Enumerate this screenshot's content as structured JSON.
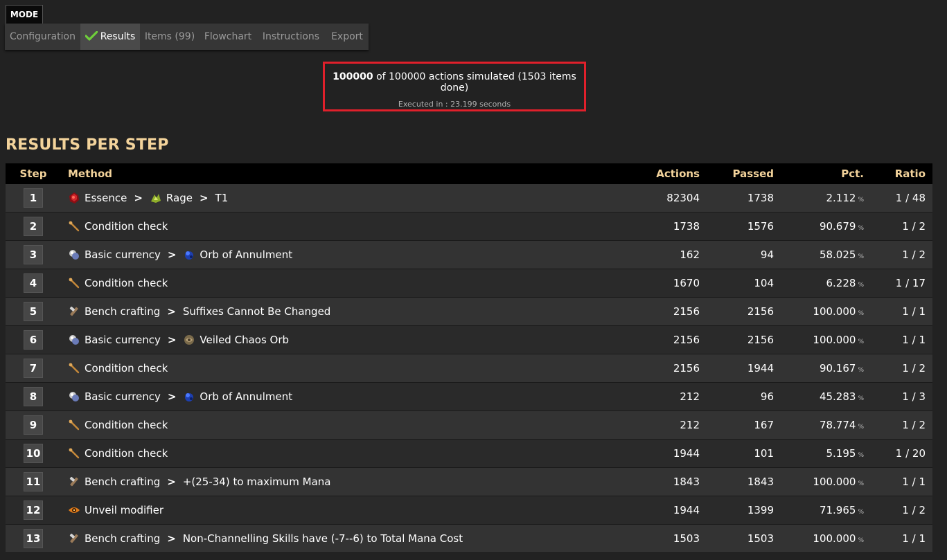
{
  "mode_label": "MODE",
  "nav": [
    {
      "label": "Configuration",
      "active": false,
      "width": 109
    },
    {
      "label": "Results",
      "active": true,
      "width": 86,
      "icon": "check-icon"
    },
    {
      "label": "Items (99)",
      "active": false,
      "width": 86
    },
    {
      "label": "Flowchart",
      "active": false,
      "width": 82
    },
    {
      "label": "Instructions",
      "active": false,
      "width": 100
    },
    {
      "label": "Export",
      "active": false,
      "width": 62
    }
  ],
  "summary": {
    "done": "100000",
    "rest": " of 100000 actions simulated (1503 items done)",
    "executed": "Executed in : 23.199 seconds"
  },
  "section_title": "RESULTS PER STEP",
  "columns": {
    "step": "Step",
    "method": "Method",
    "actions": "Actions",
    "passed": "Passed",
    "pct": "Pct.",
    "ratio": "Ratio"
  },
  "pct_unit": "%",
  "rows": [
    {
      "step": "1",
      "method": [
        {
          "icon": "essence-icon",
          "text": "Essence"
        },
        {
          "icon": "rage-essence-icon",
          "text": "Rage"
        },
        {
          "text": "T1"
        }
      ],
      "actions": "82304",
      "passed": "1738",
      "pct": "2.112",
      "ratio": "1 / 48"
    },
    {
      "step": "2",
      "method": [
        {
          "icon": "condition-check-icon",
          "text": "Condition check"
        }
      ],
      "actions": "1738",
      "passed": "1576",
      "pct": "90.679",
      "ratio": "1 / 2"
    },
    {
      "step": "3",
      "method": [
        {
          "icon": "basic-currency-icon",
          "text": "Basic currency"
        },
        {
          "icon": "orb-of-annulment-icon",
          "text": "Orb of Annulment"
        }
      ],
      "actions": "162",
      "passed": "94",
      "pct": "58.025",
      "ratio": "1 / 2"
    },
    {
      "step": "4",
      "method": [
        {
          "icon": "condition-check-icon",
          "text": "Condition check"
        }
      ],
      "actions": "1670",
      "passed": "104",
      "pct": "6.228",
      "ratio": "1 / 17"
    },
    {
      "step": "5",
      "method": [
        {
          "icon": "bench-crafting-icon",
          "text": "Bench crafting"
        },
        {
          "text": "Suffixes Cannot Be Changed"
        }
      ],
      "actions": "2156",
      "passed": "2156",
      "pct": "100.000",
      "ratio": "1 / 1"
    },
    {
      "step": "6",
      "method": [
        {
          "icon": "basic-currency-icon",
          "text": "Basic currency"
        },
        {
          "icon": "veiled-chaos-orb-icon",
          "text": "Veiled Chaos Orb"
        }
      ],
      "actions": "2156",
      "passed": "2156",
      "pct": "100.000",
      "ratio": "1 / 1"
    },
    {
      "step": "7",
      "method": [
        {
          "icon": "condition-check-icon",
          "text": "Condition check"
        }
      ],
      "actions": "2156",
      "passed": "1944",
      "pct": "90.167",
      "ratio": "1 / 2"
    },
    {
      "step": "8",
      "method": [
        {
          "icon": "basic-currency-icon",
          "text": "Basic currency"
        },
        {
          "icon": "orb-of-annulment-icon",
          "text": "Orb of Annulment"
        }
      ],
      "actions": "212",
      "passed": "96",
      "pct": "45.283",
      "ratio": "1 / 3"
    },
    {
      "step": "9",
      "method": [
        {
          "icon": "condition-check-icon",
          "text": "Condition check"
        }
      ],
      "actions": "212",
      "passed": "167",
      "pct": "78.774",
      "ratio": "1 / 2"
    },
    {
      "step": "10",
      "method": [
        {
          "icon": "condition-check-icon",
          "text": "Condition check"
        }
      ],
      "actions": "1944",
      "passed": "101",
      "pct": "5.195",
      "ratio": "1 / 20"
    },
    {
      "step": "11",
      "method": [
        {
          "icon": "bench-crafting-icon",
          "text": "Bench crafting"
        },
        {
          "text": "+(25-34) to maximum Mana"
        }
      ],
      "actions": "1843",
      "passed": "1843",
      "pct": "100.000",
      "ratio": "1 / 1"
    },
    {
      "step": "12",
      "method": [
        {
          "icon": "unveil-eye-icon",
          "text": "Unveil modifier"
        }
      ],
      "actions": "1944",
      "passed": "1399",
      "pct": "71.965",
      "ratio": "1 / 2"
    },
    {
      "step": "13",
      "method": [
        {
          "icon": "bench-crafting-icon",
          "text": "Bench crafting"
        },
        {
          "text": "Non-Channelling Skills have (-7--6) to Total Mana Cost"
        }
      ],
      "actions": "1503",
      "passed": "1503",
      "pct": "100.000",
      "ratio": "1 / 1"
    }
  ]
}
